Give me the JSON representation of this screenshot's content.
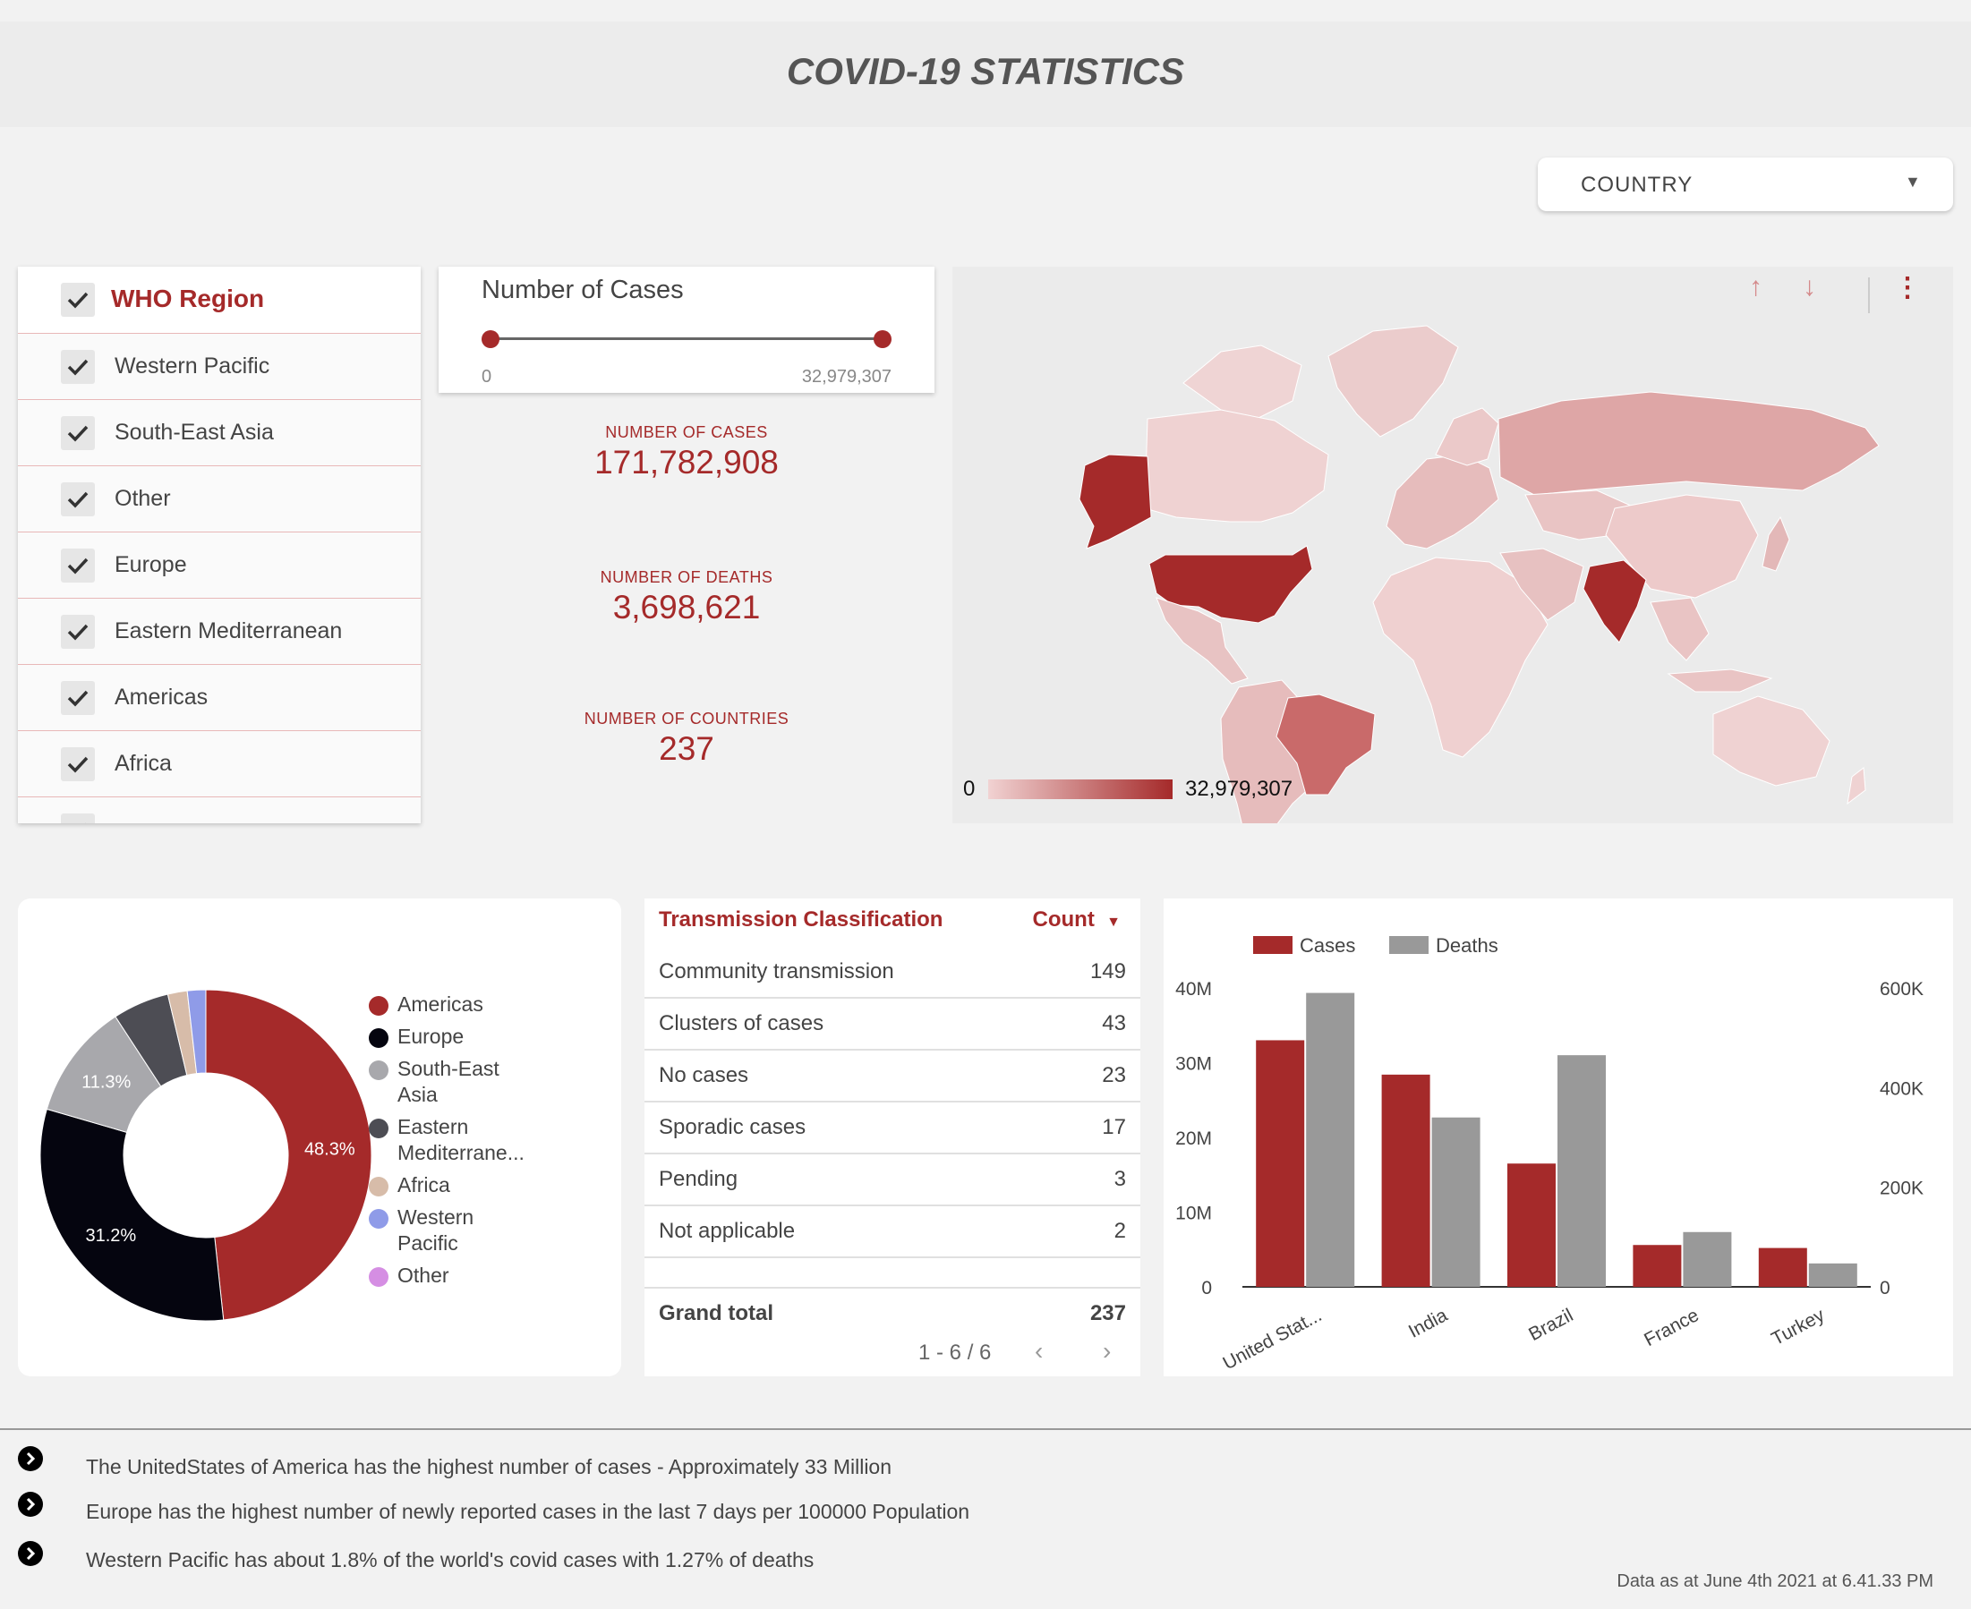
{
  "header": {
    "title": "COVID-19 STATISTICS"
  },
  "country_filter": {
    "label": "COUNTRY"
  },
  "who_filter": {
    "title": "WHO Region",
    "items": [
      {
        "label": "Western Pacific"
      },
      {
        "label": "South-East Asia"
      },
      {
        "label": "Other"
      },
      {
        "label": "Europe"
      },
      {
        "label": "Eastern Mediterranean"
      },
      {
        "label": "Americas"
      },
      {
        "label": "Africa"
      }
    ]
  },
  "slider": {
    "label": "Number of Cases",
    "min": "0",
    "max": "32,979,307"
  },
  "kpis": {
    "cases": {
      "label": "NUMBER OF CASES",
      "value": "171,782,908"
    },
    "deaths": {
      "label": "NUMBER OF DEATHS",
      "value": "3,698,621"
    },
    "countries": {
      "label": "NUMBER OF COUNTRIES",
      "value": "237"
    }
  },
  "map": {
    "scale_min": "0",
    "scale_max": "32,979,307",
    "low_color": "#f1d2d2",
    "high_color": "#a52a2a"
  },
  "donut": {
    "type": "pie",
    "slices": [
      {
        "name": "Americas",
        "value": 48.3,
        "color": "#a52a2a",
        "label": "48.3%"
      },
      {
        "name": "Europe",
        "value": 31.2,
        "color": "#05050f",
        "label": "31.2%"
      },
      {
        "name": "South-East Asia",
        "value": 11.3,
        "color": "#a8a8ac",
        "label": "11.3%"
      },
      {
        "name": "Eastern Mediterrane...",
        "value": 5.5,
        "color": "#4d4d54",
        "label": ""
      },
      {
        "name": "Africa",
        "value": 1.9,
        "color": "#d7bca9",
        "label": ""
      },
      {
        "name": "Western Pacific",
        "value": 1.8,
        "color": "#8f9be8",
        "label": ""
      },
      {
        "name": "Other",
        "value": 0.0,
        "color": "#d58ee3",
        "label": ""
      }
    ],
    "legend": [
      {
        "lines": [
          "Americas"
        ],
        "color": "#a52a2a"
      },
      {
        "lines": [
          "Europe"
        ],
        "color": "#05050f"
      },
      {
        "lines": [
          "South-East",
          "Asia"
        ],
        "color": "#a8a8ac"
      },
      {
        "lines": [
          "Eastern",
          "Mediterrane..."
        ],
        "color": "#4d4d54"
      },
      {
        "lines": [
          "Africa"
        ],
        "color": "#d7bca9"
      },
      {
        "lines": [
          "Western",
          "Pacific"
        ],
        "color": "#8f9be8"
      },
      {
        "lines": [
          "Other"
        ],
        "color": "#d58ee3"
      }
    ]
  },
  "table": {
    "col1": "Transmission Classification",
    "col2": "Count",
    "sort_icon": "▼",
    "rows": [
      {
        "name": "Community transmission",
        "count": "149"
      },
      {
        "name": "Clusters of cases",
        "count": "43"
      },
      {
        "name": "No cases",
        "count": "23"
      },
      {
        "name": "Sporadic cases",
        "count": "17"
      },
      {
        "name": "Pending",
        "count": "3"
      },
      {
        "name": "Not applicable",
        "count": "2"
      }
    ],
    "total": {
      "name": "Grand total",
      "count": "237"
    },
    "pager": "1 - 6 / 6"
  },
  "chart_data": {
    "type": "bar",
    "categories": [
      "United Stat...",
      "India",
      "Brazil",
      "France",
      "Turkey"
    ],
    "series": [
      {
        "name": "Cases",
        "axis": "left",
        "color": "#a52a2a",
        "values": [
          33000000,
          28400000,
          16500000,
          5600000,
          5200000
        ]
      },
      {
        "name": "Deaths",
        "axis": "right",
        "color": "#999999",
        "values": [
          590000,
          340000,
          465000,
          110000,
          47000
        ]
      }
    ],
    "y_left": {
      "min": 0,
      "max": 40000000,
      "ticks": [
        "0",
        "10M",
        "20M",
        "30M",
        "40M"
      ]
    },
    "y_right": {
      "min": 0,
      "max": 600000,
      "ticks": [
        "0",
        "200K",
        "400K",
        "600K"
      ]
    },
    "legend_position": "top-left"
  },
  "notes": [
    "The UnitedStates of America has the highest number of cases - Approximately 33 Million",
    "Europe has the highest number of newly reported cases in the last 7 days per 100000 Population",
    "Western Pacific has about 1.8% of the world's covid cases with 1.27% of deaths"
  ],
  "footer": {
    "as_of": "Data as at June 4th 2021 at 6.41.33 PM"
  }
}
